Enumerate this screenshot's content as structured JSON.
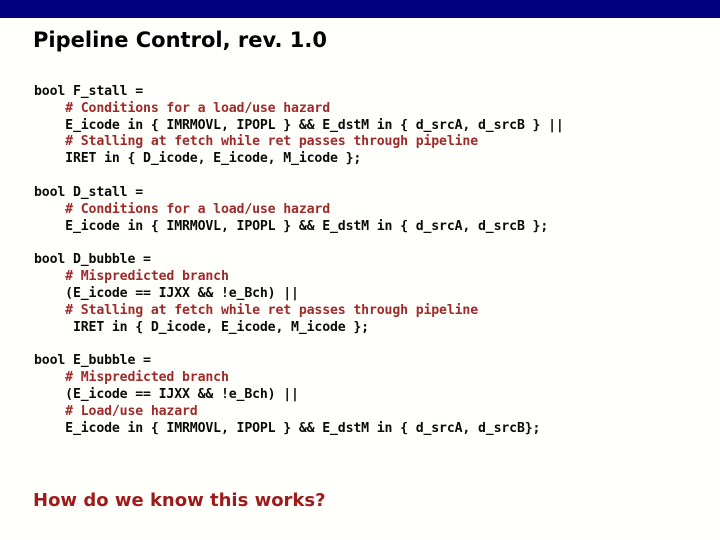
{
  "slide": {
    "title": "Pipeline Control, rev. 1.0",
    "accent_bar_color": "#000080",
    "background_color": "#fffffb",
    "code_color": "#0a0a0a",
    "comment_color": "#9e2a2a",
    "closing_color": "#9e1b1b",
    "closing_question": "How do we know this works?"
  },
  "code_blocks": [
    {
      "name": "f-stall",
      "lines": [
        {
          "text": "bool F_stall =",
          "kind": "code"
        },
        {
          "text": "    # Conditions for a load/use hazard",
          "kind": "comment"
        },
        {
          "text": "    E_icode in { IMRMOVL, IPOPL } && E_dstM in { d_srcA, d_srcB } ||",
          "kind": "code"
        },
        {
          "text": "    # Stalling at fetch while ret passes through pipeline",
          "kind": "comment"
        },
        {
          "text": "    IRET in { D_icode, E_icode, M_icode };",
          "kind": "code"
        }
      ]
    },
    {
      "name": "d-stall",
      "lines": [
        {
          "text": "bool D_stall =",
          "kind": "code"
        },
        {
          "text": "    # Conditions for a load/use hazard",
          "kind": "comment"
        },
        {
          "text": "    E_icode in { IMRMOVL, IPOPL } && E_dstM in { d_srcA, d_srcB };",
          "kind": "code"
        }
      ]
    },
    {
      "name": "d-bubble",
      "lines": [
        {
          "text": "bool D_bubble =",
          "kind": "code"
        },
        {
          "text": "    # Mispredicted branch",
          "kind": "comment"
        },
        {
          "text": "    (E_icode == IJXX && !e_Bch) ||",
          "kind": "code"
        },
        {
          "text": "    # Stalling at fetch while ret passes through pipeline",
          "kind": "comment"
        },
        {
          "text": "     IRET in { D_icode, E_icode, M_icode };",
          "kind": "code"
        }
      ]
    },
    {
      "name": "e-bubble",
      "lines": [
        {
          "text": "bool E_bubble =",
          "kind": "code"
        },
        {
          "text": "    # Mispredicted branch",
          "kind": "comment"
        },
        {
          "text": "    (E_icode == IJXX && !e_Bch) ||",
          "kind": "code"
        },
        {
          "text": "    # Load/use hazard",
          "kind": "comment"
        },
        {
          "text": "    E_icode in { IMRMOVL, IPOPL } && E_dstM in { d_srcA, d_srcB};",
          "kind": "code"
        }
      ]
    }
  ]
}
